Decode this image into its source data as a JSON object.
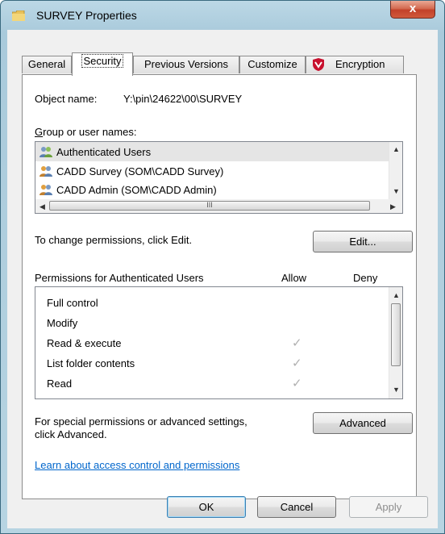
{
  "window": {
    "title": "SURVEY Properties",
    "close_glyph": "x",
    "folder_icon": "folder-icon"
  },
  "tabs": [
    {
      "label": "General"
    },
    {
      "label": "Security",
      "active": true
    },
    {
      "label": "Previous Versions"
    },
    {
      "label": "Customize"
    },
    {
      "label": "Encryption",
      "icon": "mcafee-shield-icon"
    }
  ],
  "security": {
    "object_name_label": "Object name:",
    "object_name_value": "Y:\\pin\\24622\\00\\SURVEY",
    "group_label": "Group or user names:",
    "users": [
      {
        "name": "Authenticated Users",
        "selected": true
      },
      {
        "name": "CADD Survey (SOM\\CADD Survey)"
      },
      {
        "name": "CADD Admin (SOM\\CADD Admin)"
      }
    ],
    "hscroll_grip": "III",
    "change_text": "To change permissions, click Edit.",
    "edit_button": "Edit...",
    "permissions_label": "Permissions for Authenticated Users",
    "allow_header": "Allow",
    "deny_header": "Deny",
    "permissions": [
      {
        "name": "Full control",
        "allow": false,
        "deny": false
      },
      {
        "name": "Modify",
        "allow": false,
        "deny": false
      },
      {
        "name": "Read & execute",
        "allow": true,
        "deny": false
      },
      {
        "name": "List folder contents",
        "allow": true,
        "deny": false
      },
      {
        "name": "Read",
        "allow": true,
        "deny": false
      }
    ],
    "check_glyph": "✓",
    "special_text_1": "For special permissions or advanced settings,",
    "special_text_2": "click Advanced.",
    "advanced_button": "Advanced",
    "learn_link": "Learn about access control and permissions"
  },
  "footer": {
    "ok": "OK",
    "cancel": "Cancel",
    "apply": "Apply"
  },
  "colors": {
    "accent": "#0066cc",
    "selection": "#e5e5e5",
    "close": "#c2412a"
  }
}
